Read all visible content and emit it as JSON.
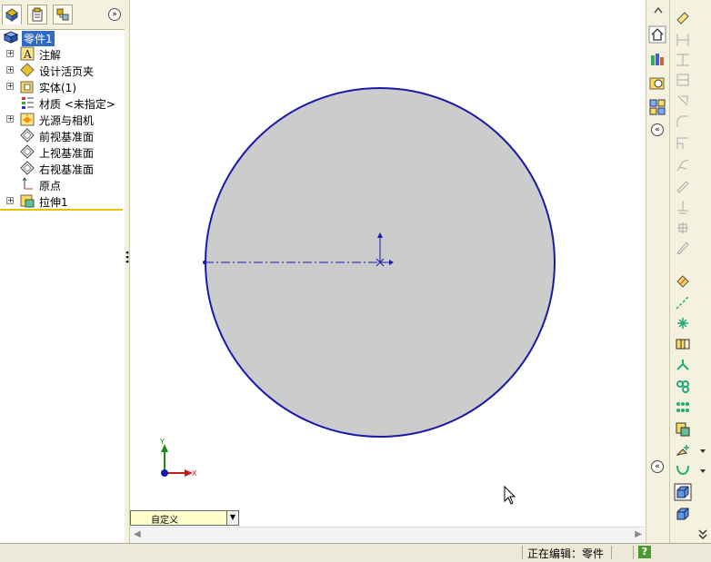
{
  "feature_tree": {
    "root": "零件1",
    "items": [
      {
        "label": "注解",
        "expandable": true,
        "icon": "annotation-icon"
      },
      {
        "label": "设计活页夹",
        "expandable": true,
        "icon": "design-binder-icon"
      },
      {
        "label": "实体(1)",
        "expandable": true,
        "icon": "solid-bodies-icon"
      },
      {
        "label": "材质 <未指定>",
        "expandable": false,
        "icon": "material-icon"
      },
      {
        "label": "光源与相机",
        "expandable": true,
        "icon": "lights-cameras-icon"
      },
      {
        "label": "前视基准面",
        "expandable": false,
        "icon": "plane-icon"
      },
      {
        "label": "上视基准面",
        "expandable": false,
        "icon": "plane-icon"
      },
      {
        "label": "右视基准面",
        "expandable": false,
        "icon": "plane-icon"
      },
      {
        "label": "原点",
        "expandable": false,
        "icon": "origin-icon"
      },
      {
        "label": "拉伸1",
        "expandable": true,
        "icon": "extrude-icon"
      }
    ]
  },
  "panel_tabs": [
    "feature-manager-tab",
    "property-manager-tab",
    "configuration-manager-tab"
  ],
  "triad": {
    "x_label": "X",
    "y_label": "Y"
  },
  "config": {
    "current": "自定义"
  },
  "status": {
    "text": "正在编辑：零件",
    "help": "?"
  },
  "colors": {
    "model_fill": "#cccccc",
    "model_edge": "#1a1aa8",
    "selection": "#316ac5",
    "panel_bg": "#f4f1de"
  }
}
